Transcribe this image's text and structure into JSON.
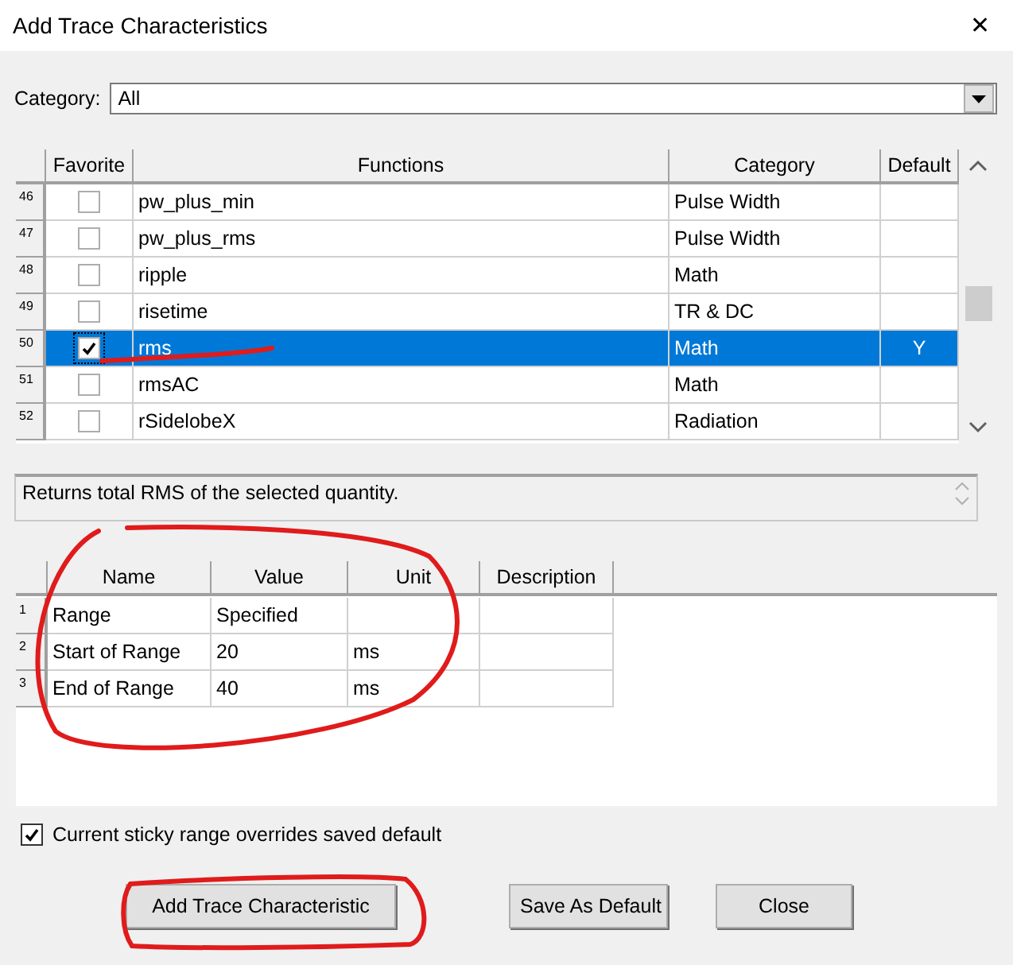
{
  "window": {
    "title": "Add Trace Characteristics",
    "close": "✕"
  },
  "category": {
    "label": "Category:",
    "value": "All"
  },
  "functions_table": {
    "columns": [
      "Favorite",
      "Functions",
      "Category",
      "Default"
    ],
    "rows": [
      {
        "number": "46",
        "favorite": false,
        "function": "pw_plus_min",
        "category": "Pulse Width",
        "default": "",
        "selected": false
      },
      {
        "number": "47",
        "favorite": false,
        "function": "pw_plus_rms",
        "category": "Pulse Width",
        "default": "",
        "selected": false
      },
      {
        "number": "48",
        "favorite": false,
        "function": "ripple",
        "category": "Math",
        "default": "",
        "selected": false
      },
      {
        "number": "49",
        "favorite": false,
        "function": "risetime",
        "category": "TR & DC",
        "default": "",
        "selected": false
      },
      {
        "number": "50",
        "favorite": true,
        "function": "rms",
        "category": "Math",
        "default": "Y",
        "selected": true
      },
      {
        "number": "51",
        "favorite": false,
        "function": "rmsAC",
        "category": "Math",
        "default": "",
        "selected": false
      },
      {
        "number": "52",
        "favorite": false,
        "function": "rSidelobeX",
        "category": "Radiation",
        "default": "",
        "selected": false
      }
    ]
  },
  "description": "Returns total RMS of the selected quantity.",
  "parameters_table": {
    "columns": [
      "Name",
      "Value",
      "Unit",
      "Description"
    ],
    "rows": [
      {
        "number": "1",
        "name": "Range",
        "value": "Specified",
        "unit": ""
      },
      {
        "number": "2",
        "name": "Start of Range",
        "value": "20",
        "unit": "ms"
      },
      {
        "number": "3",
        "name": "End of Range",
        "value": "40",
        "unit": "ms"
      }
    ]
  },
  "sticky_range": {
    "label": "Current sticky range overrides saved default",
    "checked": true
  },
  "buttons": [
    "Add Trace Characteristic",
    "Save As Default",
    "Close"
  ]
}
